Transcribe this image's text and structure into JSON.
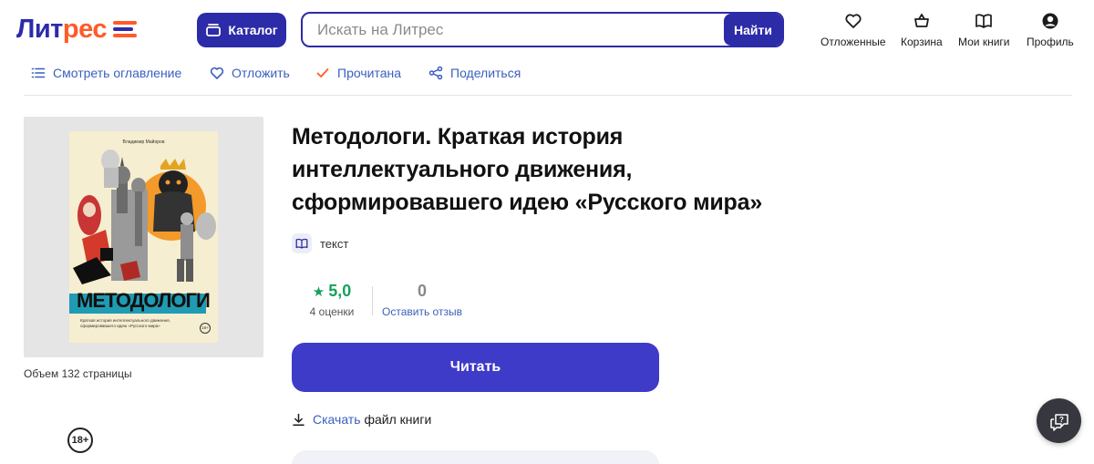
{
  "header": {
    "logo": {
      "part1": "Лит",
      "part2": "рес"
    },
    "catalog_label": "Каталог",
    "search": {
      "placeholder": "Искать на Литрес",
      "value": "",
      "button_label": "Найти"
    },
    "nav": {
      "deferred": "Отложенные",
      "cart": "Корзина",
      "my_books": "Мои книги",
      "profile": "Профиль"
    }
  },
  "actions": {
    "contents": "Смотреть оглавление",
    "defer": "Отложить",
    "read_mark": "Прочитана",
    "share": "Поделиться"
  },
  "cover": {
    "author": "Владимир Майоров",
    "title": "МЕТОДОЛОГИ",
    "subtitle": "Краткая история интеллектуального движения, сформировавшего идею «Русского мира»",
    "age_small": "18+"
  },
  "book": {
    "age_rating": "18+",
    "volume": "Объем 132 страницы",
    "title": "Методологи. Краткая история интеллектуального движения, сформировавшего идею «Русского мира»",
    "format": "текст",
    "rating": {
      "star": "★",
      "value": "5,0",
      "count": "4 оценки"
    },
    "reviews": {
      "count": "0",
      "link": "Оставить отзыв"
    },
    "read_button": "Читать",
    "download": {
      "link": "Скачать",
      "rest": "файл книги"
    }
  },
  "colors": {
    "brand_blue": "#2c2ba8",
    "brand_orange": "#ff5a29",
    "read_button": "#3e3bc9",
    "link_blue": "#3a5fbf",
    "rating_green": "#17a05d"
  }
}
